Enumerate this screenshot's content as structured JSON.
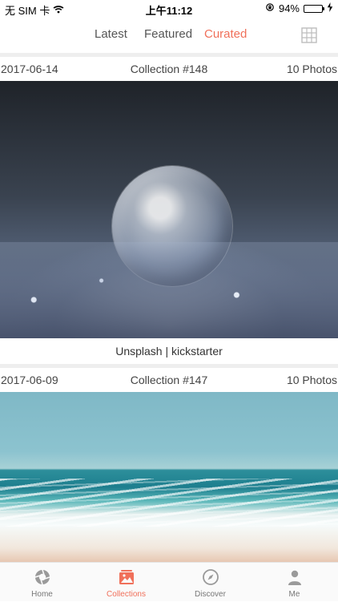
{
  "status_bar": {
    "carrier": "无 SIM 卡",
    "time": "上午11:12",
    "battery_percent": "94%",
    "battery_level": 0.94,
    "icons": [
      "wifi-icon",
      "rotation-lock-icon",
      "battery-icon",
      "charging-icon"
    ]
  },
  "top_tabs": {
    "items": [
      {
        "label": "Latest"
      },
      {
        "label": "Featured"
      },
      {
        "label": "Curated"
      }
    ],
    "active": "Curated",
    "grid_icon": "grid-view-icon"
  },
  "collections": [
    {
      "date": "2017-06-14",
      "title": "Collection #148",
      "count": "10 Photos",
      "caption": "Unsplash | kickstarter"
    },
    {
      "date": "2017-06-09",
      "title": "Collection #147",
      "count": "10 Photos"
    }
  ],
  "bottom_nav": {
    "items": [
      {
        "label": "Home",
        "icon": "aperture-icon"
      },
      {
        "label": "Collections",
        "icon": "photo-collection-icon"
      },
      {
        "label": "Discover",
        "icon": "compass-icon"
      },
      {
        "label": "Me",
        "icon": "person-icon"
      }
    ],
    "active": "Collections"
  },
  "colors": {
    "accent": "#f0705a",
    "tab_inactive": "#555555",
    "separator": "#eeeeee"
  }
}
